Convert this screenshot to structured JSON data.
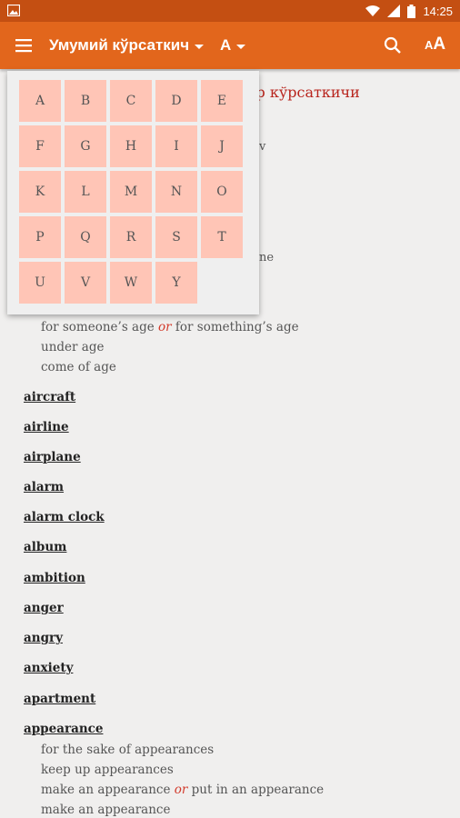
{
  "status_bar": {
    "time": "14:25",
    "icons": [
      "image-icon",
      "wifi-icon",
      "signal-icon",
      "battery-icon"
    ]
  },
  "toolbar": {
    "title": "Умумий кўрсаткич",
    "letter": "A",
    "icons": [
      "menu-icon",
      "search-icon",
      "font-size-icon"
    ]
  },
  "content": {
    "heading_partial": "ар кўрсаткичи",
    "hidden_fragments": {
      "frag1": "v",
      "frag2": "ne"
    },
    "phrases_top": [
      {
        "parts": [
          "for someone’s age ",
          "or",
          " for something’s age"
        ]
      },
      {
        "text": "under age"
      },
      {
        "text": "come of age"
      }
    ],
    "entries": [
      "aircraft",
      "airline",
      "airplane",
      "alarm",
      "alarm clock",
      "album",
      "ambition",
      "anger",
      "angry",
      "anxiety",
      "apartment",
      "appearance"
    ],
    "phrases_bottom": [
      {
        "text": "for the sake of appearances"
      },
      {
        "text": "keep up appearances"
      },
      {
        "parts": [
          "make an appearance ",
          "or",
          " put in an appearance"
        ]
      },
      {
        "text": "make an appearance"
      }
    ]
  },
  "letter_picker": {
    "letters": [
      "A",
      "B",
      "C",
      "D",
      "E",
      "F",
      "G",
      "H",
      "I",
      "J",
      "K",
      "L",
      "M",
      "N",
      "O",
      "P",
      "Q",
      "R",
      "S",
      "T",
      "U",
      "V",
      "W",
      "Y"
    ]
  },
  "colors": {
    "statusbar": "#c44f12",
    "toolbar": "#e2661c",
    "heading": "#b8251d",
    "letter_cell": "#ffc5b6",
    "or_text": "#d23a2b"
  }
}
